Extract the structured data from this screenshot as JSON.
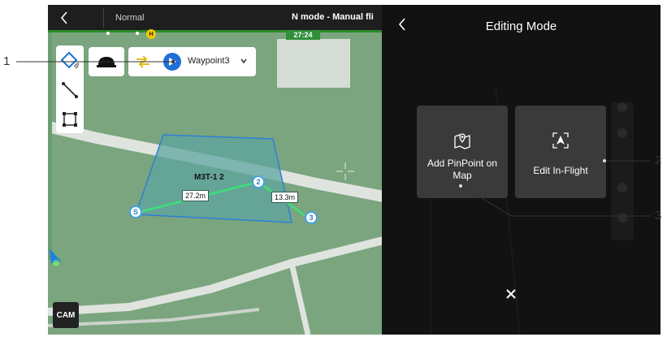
{
  "top_bar": {
    "flight_mode": "Normal",
    "mode_status": "N mode - Manual fli",
    "flight_timer": "27:24",
    "home_marker": "H"
  },
  "map": {
    "tools": [
      "polygon-icon",
      "line-icon",
      "rectangle-icon"
    ],
    "waypoint_selector": {
      "value": "Waypoint3"
    },
    "polygon_name": "M3T-1 2",
    "distances": [
      "27.2m",
      "13.3m"
    ],
    "waypoints": [
      "S",
      "2",
      "3"
    ],
    "camera_button": "CAM"
  },
  "editor": {
    "title": "Editing Mode",
    "options": [
      {
        "label": "Add PinPoint on Map",
        "icon": "map-pin-icon"
      },
      {
        "label": "Edit In-Flight",
        "icon": "edit-in-flight-icon"
      }
    ],
    "close_icon": "close-icon"
  },
  "callouts": [
    "1",
    "2",
    "3"
  ],
  "colors": {
    "map_green": "#7aa57e",
    "polygon_fill": "#5fa6a0",
    "route_line": "#3ee07a",
    "selector_blue": "#1f6fd6",
    "panel_bg": "#121212",
    "card_bg": "#3a3a3a"
  }
}
